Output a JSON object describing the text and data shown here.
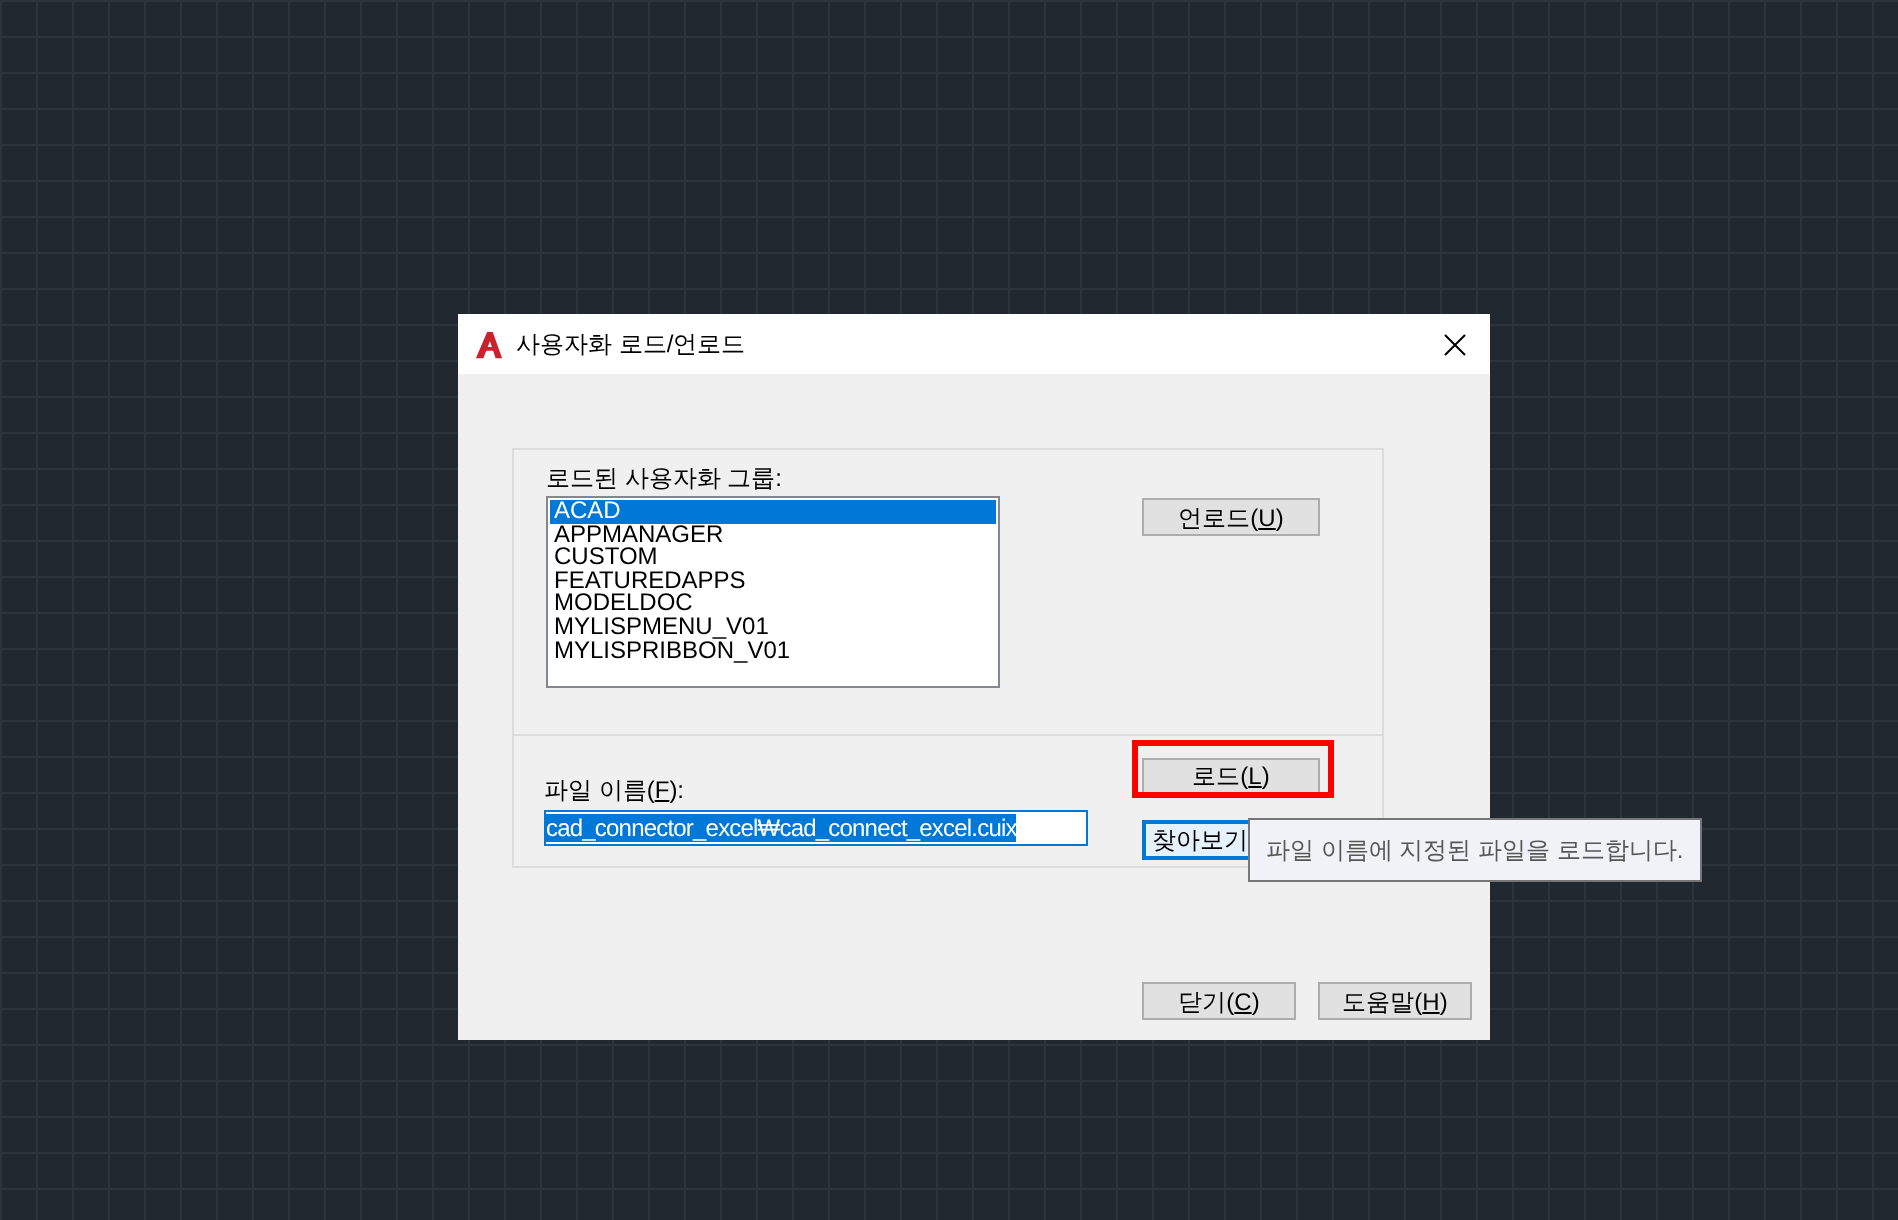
{
  "window": {
    "title": "사용자화 로드/언로드"
  },
  "loaded_groups": {
    "label": "로드된 사용자화 그룹:",
    "items": [
      {
        "label": "ACAD",
        "selected": true
      },
      {
        "label": "APPMANAGER",
        "selected": false
      },
      {
        "label": "CUSTOM",
        "selected": false
      },
      {
        "label": "FEATUREDAPPS",
        "selected": false
      },
      {
        "label": "MODELDOC",
        "selected": false
      },
      {
        "label": "MYLISPMENU_V01",
        "selected": false
      },
      {
        "label": "MYLISPRIBBON_V01",
        "selected": false
      }
    ]
  },
  "unload_button": {
    "label_start": "언로드(",
    "access_key": "U",
    "label_end": ")"
  },
  "load_button": {
    "label_start": "로드(",
    "access_key": "L",
    "label_end": ")",
    "highlighted": true
  },
  "file_name": {
    "label_start": "파일 이름(",
    "access_key": "F",
    "label_end": "):",
    "value": "cad_connector_excel₩cad_connect_excel.cuix"
  },
  "browse_button": {
    "label": "찾아보기",
    "focused": true
  },
  "tooltip": {
    "text": "파일 이름에 지정된 파일을 로드합니다."
  },
  "footer_buttons": [
    {
      "label_start": "닫기(",
      "access_key": "C",
      "label_end": ")"
    },
    {
      "label_start": "도움말(",
      "access_key": "H",
      "label_end": ")"
    }
  ]
}
